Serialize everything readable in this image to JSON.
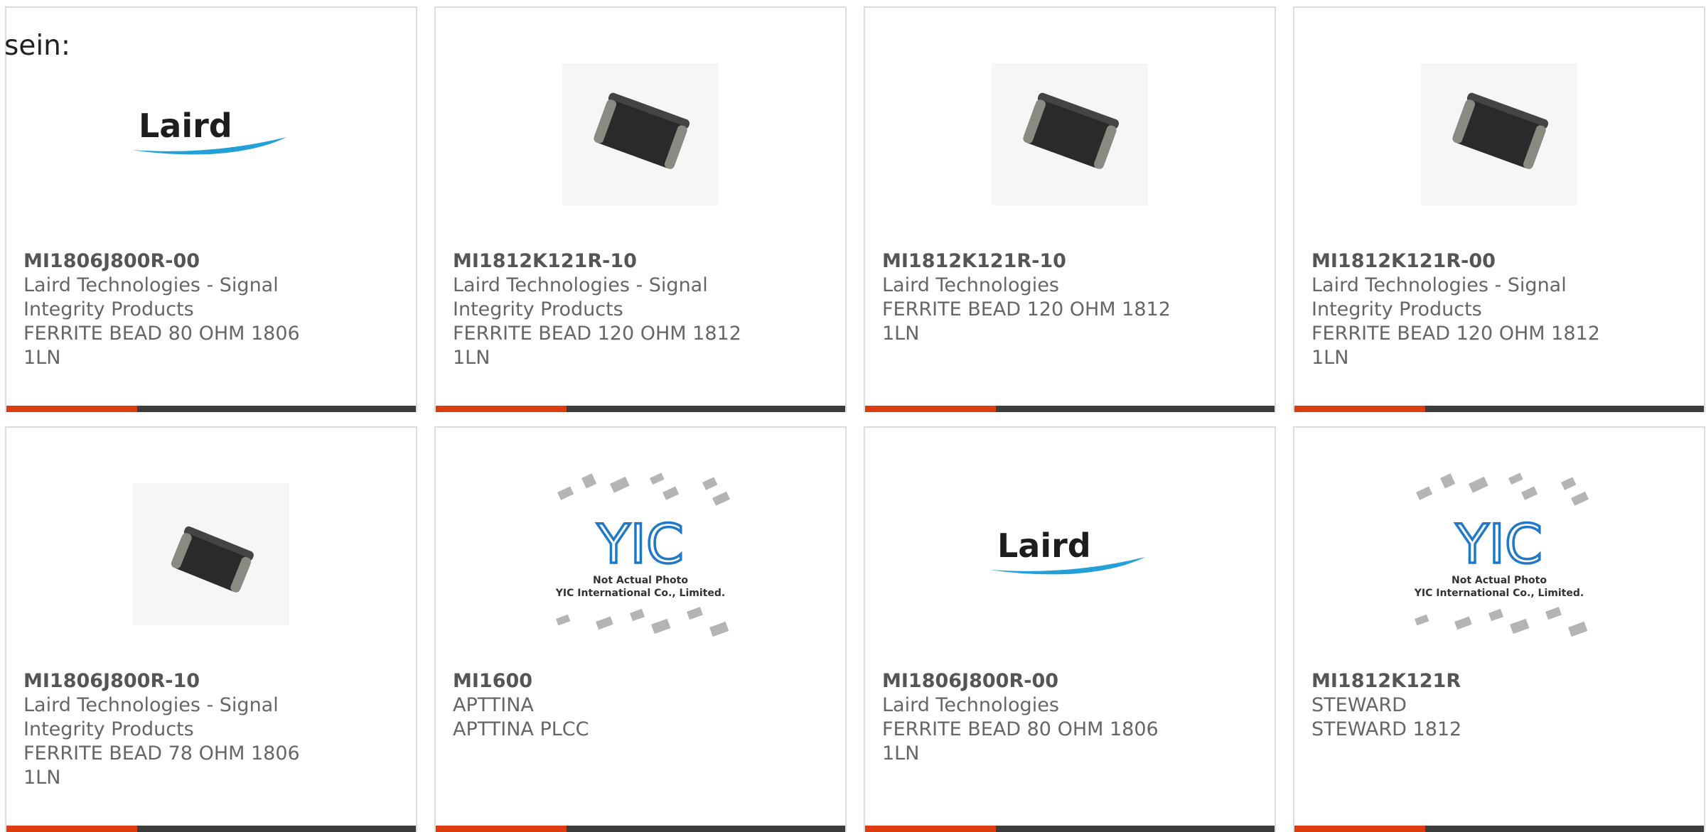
{
  "intro_text": "sein:",
  "colors": {
    "accent": "#dd3b10",
    "bar_dark": "#3c3c3c",
    "laird_blue": "#22a0d8",
    "yic_blue": "#1f78c8"
  },
  "accent_bar_fill_fraction": 0.32,
  "products": [
    {
      "part_number": "MI1806J800R-00",
      "manufacturer": "Laird Technologies - Signal Integrity Products",
      "description": "FERRITE BEAD 80 OHM 1806 1LN",
      "image_type": "laird-logo",
      "logo_text": "Laird"
    },
    {
      "part_number": "MI1812K121R-10",
      "manufacturer": "Laird Technologies - Signal Integrity Products",
      "description": "FERRITE BEAD 120 OHM 1812 1LN",
      "image_type": "ferrite-chip",
      "logo_text": ""
    },
    {
      "part_number": "MI1812K121R-10",
      "manufacturer": "Laird Technologies",
      "description": "FERRITE BEAD 120 OHM 1812 1LN",
      "image_type": "ferrite-chip",
      "logo_text": ""
    },
    {
      "part_number": "MI1812K121R-00",
      "manufacturer": "Laird Technologies - Signal Integrity Products",
      "description": "FERRITE BEAD 120 OHM 1812 1LN",
      "image_type": "ferrite-chip",
      "logo_text": ""
    },
    {
      "part_number": "MI1806J800R-10",
      "manufacturer": "Laird Technologies - Signal Integrity Products",
      "description": "FERRITE BEAD 78 OHM 1806 1LN",
      "image_type": "ferrite-chip-long",
      "logo_text": ""
    },
    {
      "part_number": "MI1600",
      "manufacturer": "APTTINA",
      "description": "APTTINA PLCC",
      "image_type": "yic-placeholder",
      "logo_text": "YIC",
      "caption_line1": "Not Actual Photo",
      "caption_line2": "YIC International Co., Limited."
    },
    {
      "part_number": "MI1806J800R-00",
      "manufacturer": "Laird Technologies",
      "description": "FERRITE BEAD 80 OHM 1806 1LN",
      "image_type": "laird-logo",
      "logo_text": "Laird"
    },
    {
      "part_number": "MI1812K121R",
      "manufacturer": "STEWARD",
      "description": "STEWARD 1812",
      "image_type": "yic-placeholder",
      "logo_text": "YIC",
      "caption_line1": "Not Actual Photo",
      "caption_line2": "YIC International Co., Limited."
    }
  ]
}
